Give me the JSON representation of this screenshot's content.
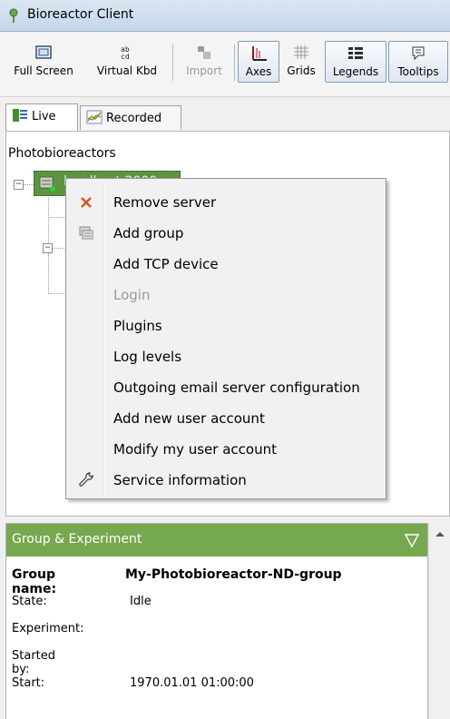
{
  "window": {
    "title": "Bioreactor Client",
    "icon": "pin-icon"
  },
  "toolbar": {
    "buttons": [
      {
        "label": "Full Screen",
        "icon": "fullscreen-icon"
      },
      {
        "label": "Virtual Kbd",
        "icon": "keyboard-icon"
      },
      {
        "label": "Import",
        "icon": "import-icon",
        "disabled": true
      },
      {
        "label": "Axes",
        "icon": "axes-icon",
        "active": true
      },
      {
        "label": "Grids",
        "icon": "grid-icon"
      },
      {
        "label": "Legends",
        "icon": "legend-icon",
        "active": true
      },
      {
        "label": "Tooltips",
        "icon": "tooltip-icon",
        "active": true
      }
    ]
  },
  "tabs": [
    {
      "label": "Live",
      "icon": "live-icon",
      "selected": true
    },
    {
      "label": "Recorded",
      "icon": "chart-icon"
    }
  ],
  "tree": {
    "root": "Photobioreactors",
    "server_node": "localhost:2000"
  },
  "context_menu": {
    "items": [
      {
        "label": "Remove server",
        "icon": "remove-x-icon"
      },
      {
        "label": "Add group",
        "icon": "add-group-icon"
      },
      {
        "label": "Add TCP device"
      },
      {
        "label": "Login",
        "disabled": true
      },
      {
        "label": "Plugins"
      },
      {
        "label": "Log levels"
      },
      {
        "label": "Outgoing email server configuration"
      },
      {
        "label": "Add new user account"
      },
      {
        "label": "Modify my user account"
      },
      {
        "label": "Service information",
        "icon": "wrench-icon"
      }
    ]
  },
  "panel": {
    "title": "Group & Experiment",
    "group_name_label": "Group name:",
    "group_name_value": "My-Photobioreactor-ND-group",
    "state_label": "State:",
    "state_value": "Idle",
    "experiment_label": "Experiment:",
    "experiment_value": "",
    "started_by_label": "Started by:",
    "started_by_value": "",
    "start_label": "Start:",
    "start_value": "1970.01.01 01:00:00"
  },
  "colors": {
    "panel_header": "#76a84f",
    "server_node_bg": "#5c9440",
    "remove_icon": "#d9531e"
  }
}
